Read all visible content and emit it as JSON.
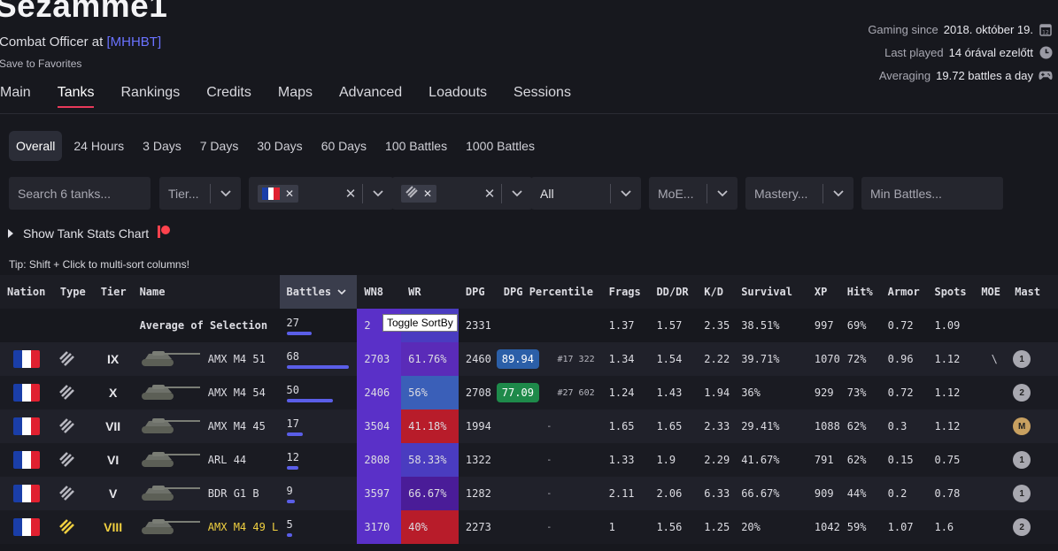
{
  "header": {
    "player_name": "Sezamme1",
    "role_prefix": "Combat Officer at",
    "clan": "[MHHBT]",
    "favorites_label": "Save to Favorites",
    "info": [
      {
        "label": "Gaming since",
        "value": "2018. október 19.",
        "icon": "calendar-icon"
      },
      {
        "label": "Last played",
        "value": "14 órával ezelőtt",
        "icon": "clock-icon"
      },
      {
        "label": "Averaging",
        "value": "19.72 battles a day",
        "icon": "gamepad-icon"
      }
    ]
  },
  "nav": {
    "items": [
      "Main",
      "Tanks",
      "Rankings",
      "Credits",
      "Maps",
      "Advanced",
      "Loadouts",
      "Sessions"
    ],
    "active": "Tanks"
  },
  "periods": {
    "items": [
      "Overall",
      "24 Hours",
      "3 Days",
      "7 Days",
      "30 Days",
      "60 Days",
      "100 Battles",
      "1000 Battles"
    ],
    "active": "Overall"
  },
  "filters": {
    "search_placeholder": "Search 6 tanks...",
    "tier_placeholder": "Tier...",
    "all_value": "All",
    "moe_placeholder": "MoE...",
    "mastery_placeholder": "Mastery...",
    "min_battles_placeholder": "Min Battles..."
  },
  "chart_toggle_label": "Show Tank Stats Chart",
  "tip": "Tip: Shift + Click to multi-sort columns!",
  "tooltip": "Toggle SortBy",
  "colors": {
    "accent": "#e8395a",
    "clan": "#6a72ff",
    "gold": "#f0d040",
    "wr_red": "#b81c2a",
    "wr_blue": "#3a5fb8",
    "wr_purple": "#5a2bb8",
    "wn8_purple": "#5a30c8"
  },
  "table": {
    "columns": [
      "Nation",
      "Type",
      "Tier",
      "Name",
      "Battles",
      "WN8",
      "WR",
      "DPG",
      "DPG Percentile",
      "Frags",
      "DD/DR",
      "K/D",
      "Survival",
      "XP",
      "Hit%",
      "Armor",
      "Spots",
      "MOE",
      "Mast"
    ],
    "sorted_column": "Battles",
    "average": {
      "label": "Average of Selection",
      "battles": "27",
      "battles_fraction": 0.4,
      "wn8": "2",
      "wr": "%",
      "dpg": "2331",
      "frags": "1.37",
      "dddr": "1.57",
      "kd": "2.35",
      "survival": "38.51%",
      "xp": "997",
      "hit": "69%",
      "armor": "0.72",
      "spots": "1.09"
    },
    "rows": [
      {
        "tier": "IX",
        "gold": false,
        "name": "AMX M4 51",
        "battles": "68",
        "battles_fraction": 1.0,
        "wn8": "2703",
        "wr": "61.76%",
        "wr_color": "#5a2bb8",
        "dpg": "2460",
        "pct": "89.94",
        "pct_color": "#2b5fa8",
        "rank": "#17 322",
        "frags": "1.34",
        "dddr": "1.54",
        "kd": "2.22",
        "survival": "39.71%",
        "xp": "1070",
        "hit": "72%",
        "armor": "0.96",
        "spots": "1.12",
        "moe": "\\",
        "mastery": "1"
      },
      {
        "tier": "X",
        "gold": false,
        "name": "AMX M4 54",
        "battles": "50",
        "battles_fraction": 0.74,
        "wn8": "2406",
        "wr": "56%",
        "wr_color": "#3a5fb8",
        "dpg": "2708",
        "pct": "77.09",
        "pct_color": "#1e8a4a",
        "rank": "#27 602",
        "frags": "1.24",
        "dddr": "1.43",
        "kd": "1.94",
        "survival": "36%",
        "xp": "929",
        "hit": "73%",
        "armor": "0.72",
        "spots": "1.12",
        "moe": "",
        "mastery": "2"
      },
      {
        "tier": "VII",
        "gold": false,
        "name": "AMX M4 45",
        "battles": "17",
        "battles_fraction": 0.25,
        "wn8": "3504",
        "wr": "41.18%",
        "wr_color": "#b81c2a",
        "dpg": "1994",
        "pct": "",
        "pct_color": "",
        "rank": "-",
        "frags": "1.65",
        "dddr": "1.65",
        "kd": "2.33",
        "survival": "29.41%",
        "xp": "1088",
        "hit": "62%",
        "armor": "0.3",
        "spots": "1.12",
        "moe": "",
        "mastery": "M"
      },
      {
        "tier": "VI",
        "gold": false,
        "name": "ARL 44",
        "battles": "12",
        "battles_fraction": 0.18,
        "wn8": "2808",
        "wr": "58.33%",
        "wr_color": "#4a3cc0",
        "dpg": "1322",
        "pct": "",
        "pct_color": "",
        "rank": "-",
        "frags": "1.33",
        "dddr": "1.9",
        "kd": "2.29",
        "survival": "41.67%",
        "xp": "791",
        "hit": "62%",
        "armor": "0.15",
        "spots": "0.75",
        "moe": "",
        "mastery": "1"
      },
      {
        "tier": "V",
        "gold": false,
        "name": "BDR G1 B",
        "battles": "9",
        "battles_fraction": 0.13,
        "wn8": "3597",
        "wr": "66.67%",
        "wr_color": "#4a1c98",
        "dpg": "1282",
        "pct": "",
        "pct_color": "",
        "rank": "-",
        "frags": "2.11",
        "dddr": "2.06",
        "kd": "6.33",
        "survival": "66.67%",
        "xp": "909",
        "hit": "44%",
        "armor": "0.2",
        "spots": "0.78",
        "moe": "",
        "mastery": "1"
      },
      {
        "tier": "VIII",
        "gold": true,
        "name": "AMX M4 49 L",
        "battles": "5",
        "battles_fraction": 0.07,
        "wn8": "3170",
        "wr": "40%",
        "wr_color": "#b81c2a",
        "dpg": "2273",
        "pct": "",
        "pct_color": "",
        "rank": "-",
        "frags": "1",
        "dddr": "1.56",
        "kd": "1.25",
        "survival": "20%",
        "xp": "1042",
        "hit": "59%",
        "armor": "1.07",
        "spots": "1.6",
        "moe": "",
        "mastery": "2"
      }
    ]
  }
}
